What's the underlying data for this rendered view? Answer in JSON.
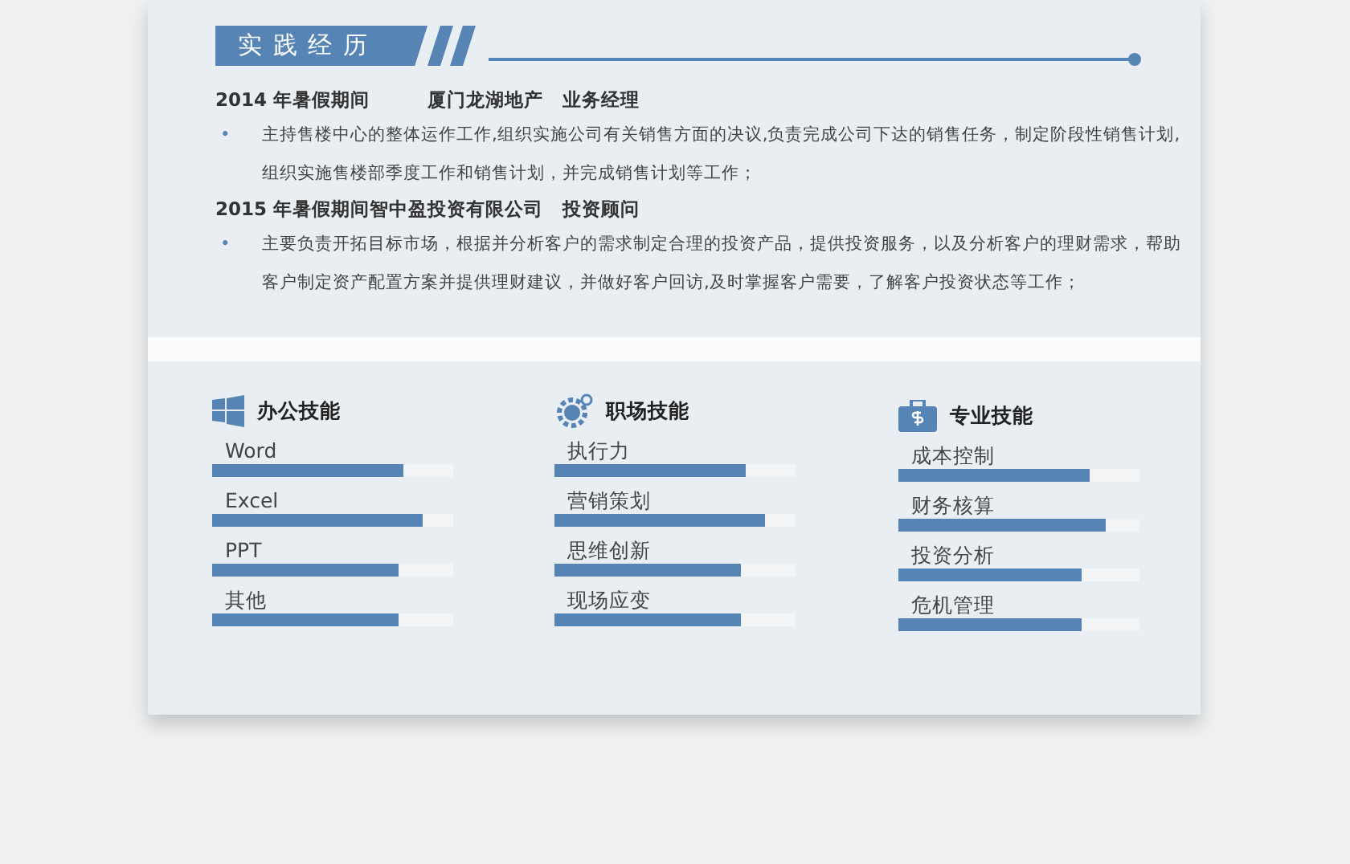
{
  "section_title": "实 践 经 历",
  "experience": [
    {
      "heading": "2014 年暑假期间",
      "company": "厦门龙湖地产",
      "role": "业务经理",
      "bullet": "•",
      "text": "主持售楼中心的整体运作工作,组织实施公司有关销售方面的决议,负责完成公司下达的销售任务，制定阶段性销售计划,组织实施售楼部季度工作和销售计划，并完成销售计划等工作；"
    },
    {
      "heading": "2015 年暑假期间智中盈投资有限公司",
      "role": "投资顾问",
      "bullet": "•",
      "text": "主要负责开拓目标市场，根据并分析客户的需求制定合理的投资产品，提供投资服务，以及分析客户的理财需求，帮助客户制定资产配置方案并提供理财建议，并做好客户回访,及时掌握客户需要，了解客户投资状态等工作；"
    }
  ],
  "skill_groups": [
    {
      "kind": "windows",
      "title": "办公技能",
      "skills": [
        {
          "name": "Word",
          "level": 0.79
        },
        {
          "name": "Excel",
          "level": 0.87
        },
        {
          "name": "PPT",
          "level": 0.77
        },
        {
          "name": "其他",
          "level": 0.77
        }
      ]
    },
    {
      "kind": "gear",
      "title": "职场技能",
      "skills": [
        {
          "name": "执行力",
          "level": 0.79
        },
        {
          "name": "营销策划",
          "level": 0.87
        },
        {
          "name": "思维创新",
          "level": 0.77
        },
        {
          "name": "现场应变",
          "level": 0.77
        }
      ]
    },
    {
      "kind": "case",
      "title": "专业技能",
      "skills": [
        {
          "name": "成本控制",
          "level": 0.79
        },
        {
          "name": "财务核算",
          "level": 0.86
        },
        {
          "name": "投资分析",
          "level": 0.76
        },
        {
          "name": "危机管理",
          "level": 0.76
        }
      ]
    }
  ]
}
